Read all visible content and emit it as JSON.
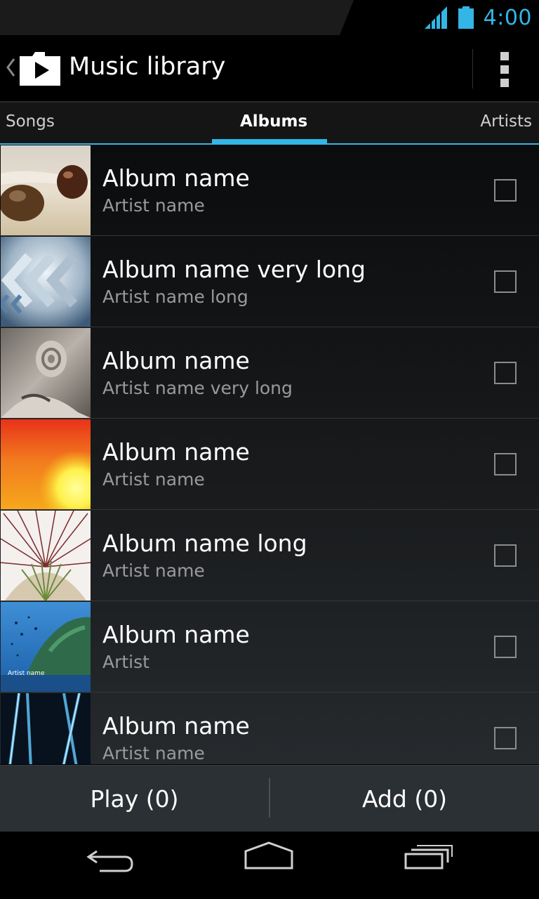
{
  "status_bar": {
    "time": "4:00"
  },
  "action_bar": {
    "title": "Music library"
  },
  "tabs": [
    "Songs",
    "Albums",
    "Artists"
  ],
  "albums": [
    {
      "album": "Album name",
      "artist": "Artist name"
    },
    {
      "album": "Album name very long",
      "artist": "Artist name long"
    },
    {
      "album": "Album name",
      "artist": "Artist name very long"
    },
    {
      "album": "Album name",
      "artist": "Artist name"
    },
    {
      "album": "Album name long",
      "artist": "Artist name"
    },
    {
      "album": "Album name",
      "artist": "Artist",
      "cover_text": "Artist name"
    },
    {
      "album": "Album name",
      "artist": "Artist name"
    }
  ],
  "button_bar": {
    "play": "Play (0)",
    "add": "Add (0)"
  },
  "colors": {
    "accent": "#33b5e5",
    "background": "#000000"
  }
}
